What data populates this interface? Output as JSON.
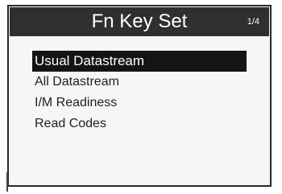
{
  "header": {
    "title": "Fn Key Set",
    "page_indicator": "1/4"
  },
  "menu": {
    "items": [
      {
        "label": "Usual Datastream",
        "selected": true
      },
      {
        "label": "All Datastream",
        "selected": false
      },
      {
        "label": "I/M Readiness",
        "selected": false
      },
      {
        "label": "Read Codes",
        "selected": false
      }
    ]
  },
  "colors": {
    "header_bg": "#2f2f2f",
    "highlight_bg": "#141414",
    "screen_bg": "#f6f6f6",
    "text": "#1e1e1e"
  }
}
